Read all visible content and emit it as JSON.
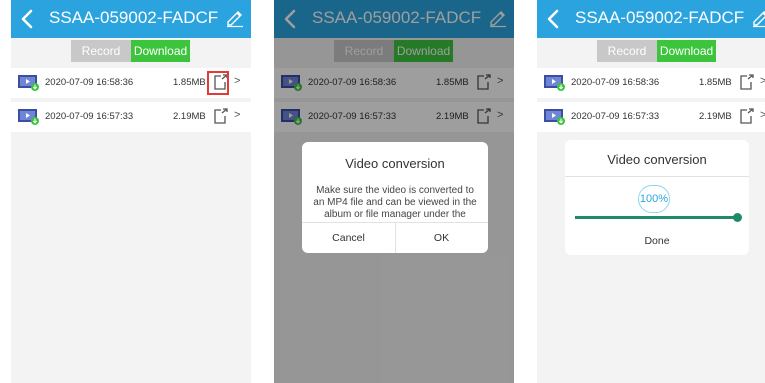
{
  "colors": {
    "header": "#2aa3df",
    "tab_active": "#3cc53c",
    "tab_inactive": "#c8c8c8",
    "highlight": "#e53935",
    "progress": "#1f8a6b"
  },
  "header": {
    "title": "SSAA-059002-FADCF",
    "back_icon": "chevron-left-icon",
    "edit_icon": "pencil-icon"
  },
  "tabs": {
    "record": "Record",
    "download": "Download",
    "active": "Download"
  },
  "files": [
    {
      "date": "2020-07-09 16:58:36",
      "size": "1.85MB"
    },
    {
      "date": "2020-07-09 16:57:33",
      "size": "2.19MB"
    }
  ],
  "dialog_confirm": {
    "title": "Video conversion",
    "message": "Make sure the video is converted to an MP4 file and can be viewed in the album or file manager under the",
    "cancel": "Cancel",
    "ok": "OK"
  },
  "dialog_progress": {
    "title": "Video conversion",
    "percent_label": "100%",
    "progress": 1.0,
    "done": "Done"
  },
  "chevron": ">"
}
